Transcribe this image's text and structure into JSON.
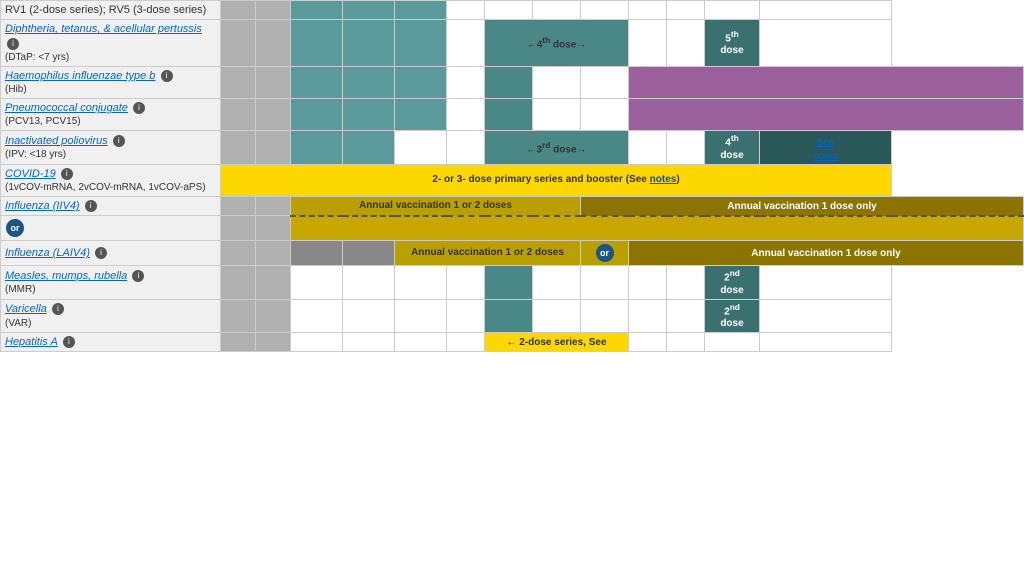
{
  "rows": [
    {
      "id": "rv",
      "nameHtml": "RV1 (2-dose series); RV5 (3-dose series)",
      "nameLink": false,
      "subtext": "",
      "infoIcon": false
    },
    {
      "id": "dtap",
      "nameHtml": "Diphtheria, tetanus, &amp; acellular pertussis",
      "nameLink": true,
      "subtext": "(DTaP: &lt;7 yrs)",
      "infoIcon": true,
      "arrowCell": "←4th dose→",
      "dose5": "5th dose"
    },
    {
      "id": "hib",
      "nameHtml": "Haemophilus influenzae type b",
      "nameLink": true,
      "nameItalic": true,
      "subtext": "(Hib)",
      "infoIcon": true
    },
    {
      "id": "pneumo",
      "nameHtml": "Pneumococcal conjugate",
      "nameLink": true,
      "subtext": "(PCV13, PCV15)",
      "infoIcon": true
    },
    {
      "id": "ipv",
      "nameHtml": "Inactivated poliovirus",
      "nameLink": true,
      "subtext": "(IPV: &lt;18 yrs)",
      "infoIcon": true,
      "arrowCell": "←3rd dose→",
      "dose4": "4th dose",
      "seeNotes": "See notes"
    },
    {
      "id": "covid",
      "nameHtml": "COVID-19",
      "nameLink": true,
      "subtext": "(1vCOV-mRNA, 2vCOV-mRNA, 1vCOV-aPS)",
      "infoIcon": true,
      "spanText": "2- or 3- dose primary series and booster (See notes)"
    },
    {
      "id": "influenza-iiv4",
      "nameHtml": "Influenza (IIV4)",
      "nameLink": true,
      "infoIcon": true,
      "leftText": "Annual vaccination 1 or 2 doses",
      "rightText": "Annual vaccination 1 dose only"
    },
    {
      "id": "or-row",
      "isOrRow": true,
      "orLabel": "or"
    },
    {
      "id": "influenza-laiv4",
      "nameHtml": "Influenza (LAIV4)",
      "nameLink": true,
      "infoIcon": true,
      "leftText": "Annual vaccination 1 or 2 doses",
      "rightText": "Annual vaccination 1 dose only"
    },
    {
      "id": "mmr",
      "nameHtml": "Measles, mumps, rubella",
      "nameLink": true,
      "subtext": "(MMR)",
      "infoIcon": true,
      "dose2": "2nd dose"
    },
    {
      "id": "varicella",
      "nameHtml": "Varicella",
      "nameLink": true,
      "subtext": "(VAR)",
      "infoIcon": true,
      "dose2": "2nd dose"
    },
    {
      "id": "hepa",
      "nameHtml": "Hepatitis A",
      "nameLink": true,
      "infoIcon": true,
      "arrowText": "← 2-dose series, See"
    }
  ],
  "labels": {
    "info": "i",
    "or": "or",
    "seeNotes": "See notes",
    "covidSpan": "2- or 3- dose primary series and booster (See ",
    "covidNotesLink": "notes",
    "covidSpanEnd": ")"
  }
}
